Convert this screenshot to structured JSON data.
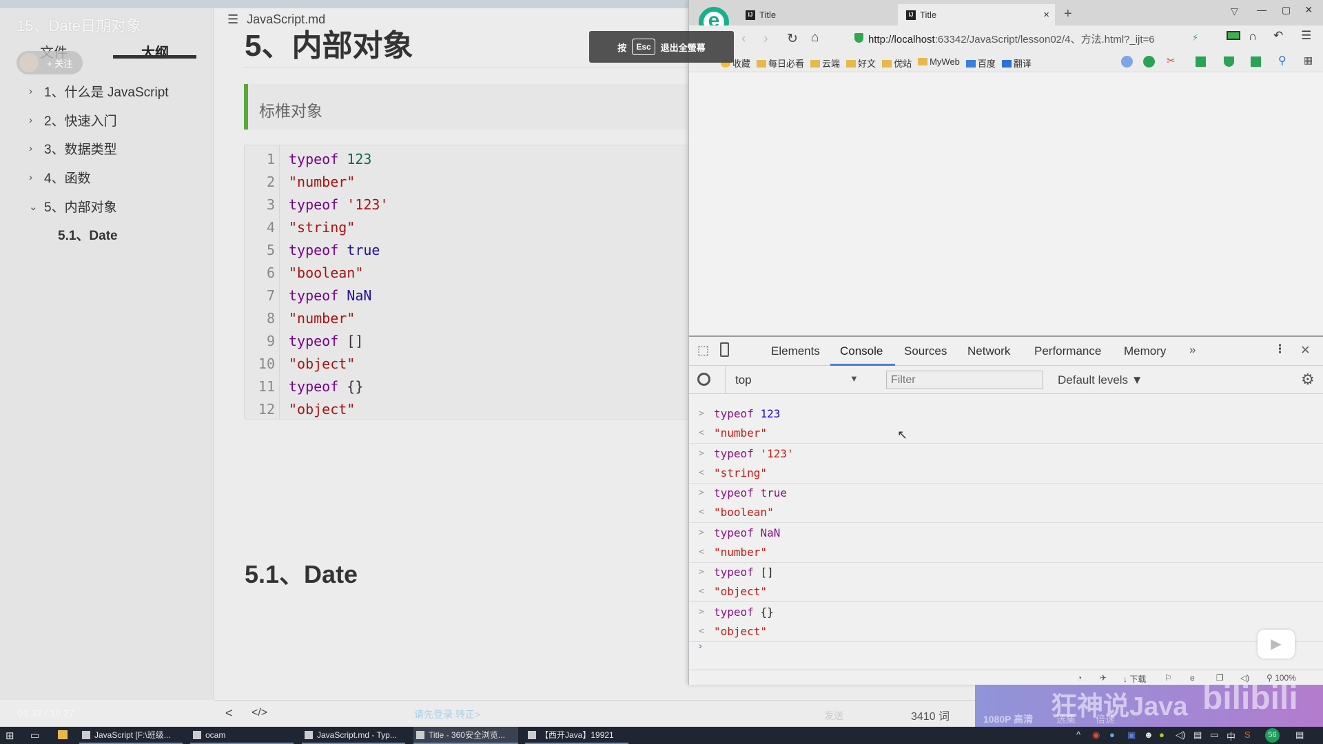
{
  "video": {
    "title": "15、Date日期对象",
    "follow_label": "+ 关注",
    "time": "01:32 / 10:27",
    "quality": "1080P 高清",
    "episodes": "选集",
    "speed": "倍速",
    "danmaku_hint": "请先登录 转正>",
    "send": "发送",
    "watermark": "狂神说Java",
    "brand": "bilibili"
  },
  "sidebar": {
    "tabs": [
      {
        "label": "文件"
      },
      {
        "label": "大纲",
        "active": true
      }
    ],
    "outline": [
      {
        "label": "1、什么是 JavaScript",
        "expanded": false
      },
      {
        "label": "2、快速入门",
        "expanded": false
      },
      {
        "label": "3、数据类型",
        "expanded": false
      },
      {
        "label": "4、函数",
        "expanded": false
      },
      {
        "label": "5、内部对象",
        "expanded": true
      },
      {
        "label": "5.1、Date",
        "child": true
      }
    ]
  },
  "editor": {
    "filename": "JavaScript.md",
    "heading": "5、内部对象",
    "quote": "标椎对象",
    "code": [
      [
        {
          "t": "typeof ",
          "c": "kw"
        },
        {
          "t": "123",
          "c": "num"
        }
      ],
      [
        {
          "t": "\"number\"",
          "c": "str"
        }
      ],
      [
        {
          "t": "typeof ",
          "c": "kw"
        },
        {
          "t": "'123'",
          "c": "str"
        }
      ],
      [
        {
          "t": "\"string\"",
          "c": "str"
        }
      ],
      [
        {
          "t": "typeof ",
          "c": "kw"
        },
        {
          "t": "true",
          "c": "atom"
        }
      ],
      [
        {
          "t": "\"boolean\"",
          "c": "str"
        }
      ],
      [
        {
          "t": "typeof ",
          "c": "kw"
        },
        {
          "t": "NaN",
          "c": "atom"
        }
      ],
      [
        {
          "t": "\"number\"",
          "c": "str"
        }
      ],
      [
        {
          "t": "typeof ",
          "c": "kw"
        },
        {
          "t": "[]",
          "c": "pl"
        }
      ],
      [
        {
          "t": "\"object\"",
          "c": "str"
        }
      ],
      [
        {
          "t": "typeof ",
          "c": "kw"
        },
        {
          "t": "{}",
          "c": "pl"
        }
      ],
      [
        {
          "t": "\"object\"",
          "c": "str"
        }
      ]
    ],
    "subheading": "5.1、Date",
    "word_count": "3410 词",
    "nav_back": "<",
    "source_toggle": "</>"
  },
  "toast": {
    "prefix": "按",
    "key": "Esc",
    "text": "退出全螢幕"
  },
  "browser": {
    "tabs": [
      {
        "label": "Title"
      },
      {
        "label": "Title",
        "active": true
      }
    ],
    "new_tab": "+",
    "close_tab": "×",
    "url_host": "http://localhost",
    "url_rest": ":63342/JavaScript/lesson02/4、方法.html?_ijt=6",
    "bookmarks": [
      "收藏",
      "每日必看",
      "云端",
      "好文",
      "优站",
      "MyWeb",
      "百度",
      "翻译"
    ],
    "status": {
      "download": "下载",
      "zoom": "100%"
    }
  },
  "devtools": {
    "tabs": [
      "Elements",
      "Console",
      "Sources",
      "Network",
      "Performance",
      "Memory"
    ],
    "active_tab": "Console",
    "more": "»",
    "context": "top",
    "filter_placeholder": "Filter",
    "levels": "Default levels ▼",
    "messages": [
      {
        "in": [
          {
            "t": "typeof ",
            "c": "ck"
          },
          {
            "t": "123",
            "c": "cn"
          }
        ],
        "out": "\"number\""
      },
      {
        "in": [
          {
            "t": "typeof ",
            "c": "ck"
          },
          {
            "t": "'123'",
            "c": "cs"
          }
        ],
        "out": "\"string\""
      },
      {
        "in": [
          {
            "t": "typeof ",
            "c": "ck"
          },
          {
            "t": "true",
            "c": "ck"
          }
        ],
        "out": "\"boolean\""
      },
      {
        "in": [
          {
            "t": "typeof ",
            "c": "ck"
          },
          {
            "t": "NaN",
            "c": "ck"
          }
        ],
        "out": "\"number\""
      },
      {
        "in": [
          {
            "t": "typeof ",
            "c": "ck"
          },
          {
            "t": "[]",
            "c": "cp"
          }
        ],
        "out": "\"object\""
      },
      {
        "in": [
          {
            "t": "typeof ",
            "c": "ck"
          },
          {
            "t": "{}",
            "c": "cp"
          }
        ],
        "out": "\"object\""
      }
    ]
  },
  "taskbar": {
    "items": [
      "JavaScript [F:\\班级...",
      "ocam",
      "JavaScript.md - Typ...",
      "Title - 360安全浏览...",
      "【西开Java】19921"
    ],
    "ime": "中",
    "badge": "56"
  },
  "colors": {
    "accent_green": "#58a83a",
    "devtools_active": "#4a7fd4",
    "bili_purple": "#a784d4"
  }
}
